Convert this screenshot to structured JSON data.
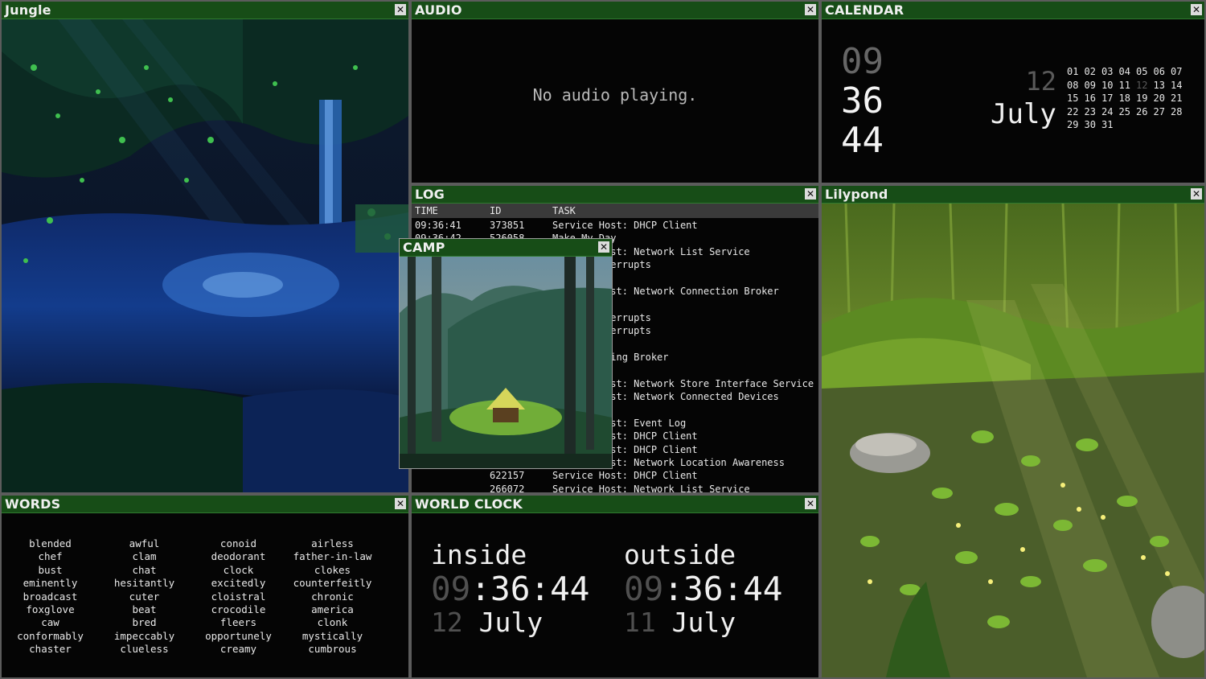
{
  "jungle": {
    "title": "Jungle",
    "close": "✕"
  },
  "audio": {
    "title": "AUDIO",
    "close": "✕",
    "message": "No audio playing."
  },
  "calendar": {
    "title": "CALENDAR",
    "close": "✕",
    "hour": "09",
    "minute": "36",
    "second": "44",
    "day": "12",
    "month": "July",
    "weeks": [
      [
        "01",
        "02",
        "03",
        "04",
        "05",
        "06",
        "07"
      ],
      [
        "08",
        "09",
        "10",
        "11",
        "12",
        "13",
        "14"
      ],
      [
        "15",
        "16",
        "17",
        "18",
        "19",
        "20",
        "21"
      ],
      [
        "22",
        "23",
        "24",
        "25",
        "26",
        "27",
        "28"
      ],
      [
        "29",
        "30",
        "31"
      ]
    ],
    "today": "12"
  },
  "log": {
    "title": "LOG",
    "close": "✕",
    "columns": [
      "TIME",
      "ID",
      "TASK"
    ],
    "rows": [
      [
        "09:36:41",
        "373851",
        "Service Host: DHCP Client"
      ],
      [
        "09:36:42",
        "526058",
        "Make My Day"
      ],
      [
        "",
        "",
        "Service Host: Network List Service"
      ],
      [
        "",
        "",
        "System Interrupts"
      ],
      [
        "",
        "",
        ""
      ],
      [
        "",
        "",
        "Service Host: Network Connection Broker"
      ],
      [
        "",
        "",
        ""
      ],
      [
        "",
        "",
        "System Interrupts"
      ],
      [
        "",
        "",
        "System Interrupts"
      ],
      [
        "",
        "",
        ""
      ],
      [
        "",
        "",
        "Time Tracking Broker"
      ],
      [
        "",
        "",
        ""
      ],
      [
        "",
        "",
        "Service Host: Network Store Interface Service"
      ],
      [
        "",
        "",
        "Service Host: Network Connected Devices"
      ],
      [
        "",
        "",
        ""
      ],
      [
        "",
        "",
        "Service Host: Event Log"
      ],
      [
        "",
        "",
        "Service Host: DHCP Client"
      ],
      [
        "",
        "",
        "Service Host: DHCP Client"
      ],
      [
        "",
        "",
        "Service Host: Network Location Awareness"
      ],
      [
        "",
        "622157",
        "Service Host: DHCP Client"
      ],
      [
        "",
        "266072",
        "Service Host: Network List Service"
      ]
    ]
  },
  "camp": {
    "title": "CAMP",
    "close": "✕"
  },
  "lilypond": {
    "title": "Lilypond",
    "close": "✕"
  },
  "words": {
    "title": "WORDS",
    "close": "✕",
    "columns": [
      [
        "blended",
        "chef",
        "bust",
        "eminently",
        "broadcast",
        "foxglove",
        "caw",
        "conformably",
        "chaster"
      ],
      [
        "awful",
        "clam",
        "chat",
        "hesitantly",
        "cuter",
        "beat",
        "bred",
        "impeccably",
        "clueless"
      ],
      [
        "conoid",
        "deodorant",
        "clock",
        "excitedly",
        "cloistral",
        "crocodile",
        "fleers",
        "opportunely",
        "creamy"
      ],
      [
        "airless",
        "father-in-law",
        "clokes",
        "counterfeitly",
        "chronic",
        "america",
        "clonk",
        "mystically",
        "cumbrous"
      ]
    ]
  },
  "world_clock": {
    "title": "WORLD CLOCK",
    "close": "✕",
    "inside": {
      "label": "inside",
      "hour": "09",
      "rest": ":36:44",
      "day": "12",
      "month": "July"
    },
    "outside": {
      "label": "outside",
      "hour": "09",
      "rest": ":36:44",
      "day": "11",
      "month": "July"
    }
  },
  "colors": {
    "titlebar": "#174d17",
    "panel_bg": "#050505",
    "text": "#e6e6e6",
    "dim": "#5a5a5a"
  }
}
